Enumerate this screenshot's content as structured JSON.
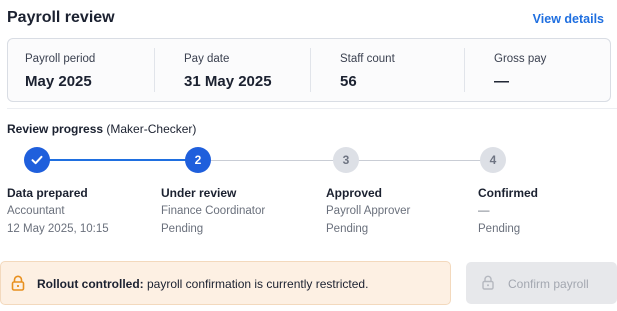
{
  "header": {
    "title": "Payroll review",
    "view_details": "View details"
  },
  "summary": [
    {
      "label": "Payroll period",
      "value": "May 2025"
    },
    {
      "label": "Pay date",
      "value": "31 May 2025"
    },
    {
      "label": "Staff count",
      "value": "56"
    },
    {
      "label": "Gross pay",
      "value": "—"
    }
  ],
  "progress": {
    "title": "Review progress",
    "subtitle": "(Maker-Checker)",
    "steps": [
      {
        "number": "",
        "state": "completed",
        "name": "Data prepared",
        "role": "Accountant",
        "status": "12 May 2025, 10:15"
      },
      {
        "number": "2",
        "state": "current",
        "name": "Under review",
        "role": "Finance Coordinator",
        "status": "Pending"
      },
      {
        "number": "3",
        "state": "pending",
        "name": "Approved",
        "role": "Payroll Approver",
        "status": "Pending"
      },
      {
        "number": "4",
        "state": "pending",
        "name": "Confirmed",
        "role": "—",
        "status": "Pending"
      }
    ]
  },
  "alert": {
    "strong": "Rollout controlled:",
    "text": " payroll confirmation is currently restricted."
  },
  "confirm_button": {
    "label": "Confirm payroll",
    "disabled": true
  },
  "colors": {
    "accent": "#1f5fdc",
    "link": "#1f6fe0",
    "warning_bg": "#fdf0e3",
    "warning_icon": "#e8901f"
  }
}
